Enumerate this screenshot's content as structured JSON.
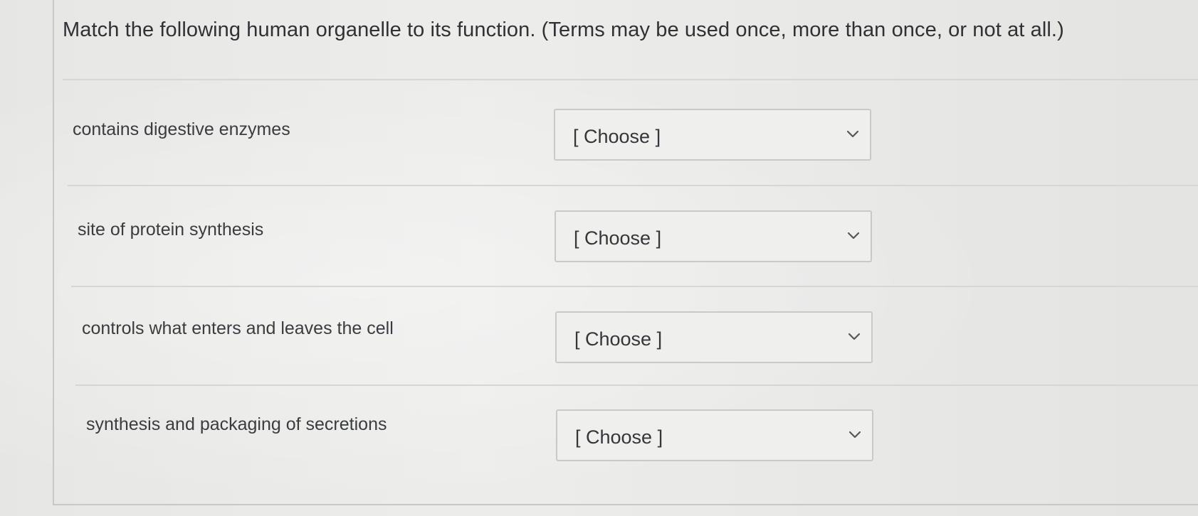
{
  "question": {
    "text": "Match the following human organelle to its function. (Terms may be used once, more than once, or not at all.)"
  },
  "items": [
    {
      "prompt": "contains digestive enzymes",
      "selected": "[ Choose ]",
      "icon": "chevron-down-icon"
    },
    {
      "prompt": "site of protein synthesis",
      "selected": "[ Choose ]",
      "icon": "chevron-down-icon"
    },
    {
      "prompt": "controls what enters and leaves the cell",
      "selected": "[ Choose ]",
      "icon": "chevron-down-icon"
    },
    {
      "prompt": "synthesis and packaging of secretions",
      "selected": "[ Choose ]",
      "icon": "chevron-down-icon"
    }
  ],
  "colors": {
    "background": "#ebebe9",
    "border": "#c9c9c6",
    "text": "#3a3c3f"
  }
}
